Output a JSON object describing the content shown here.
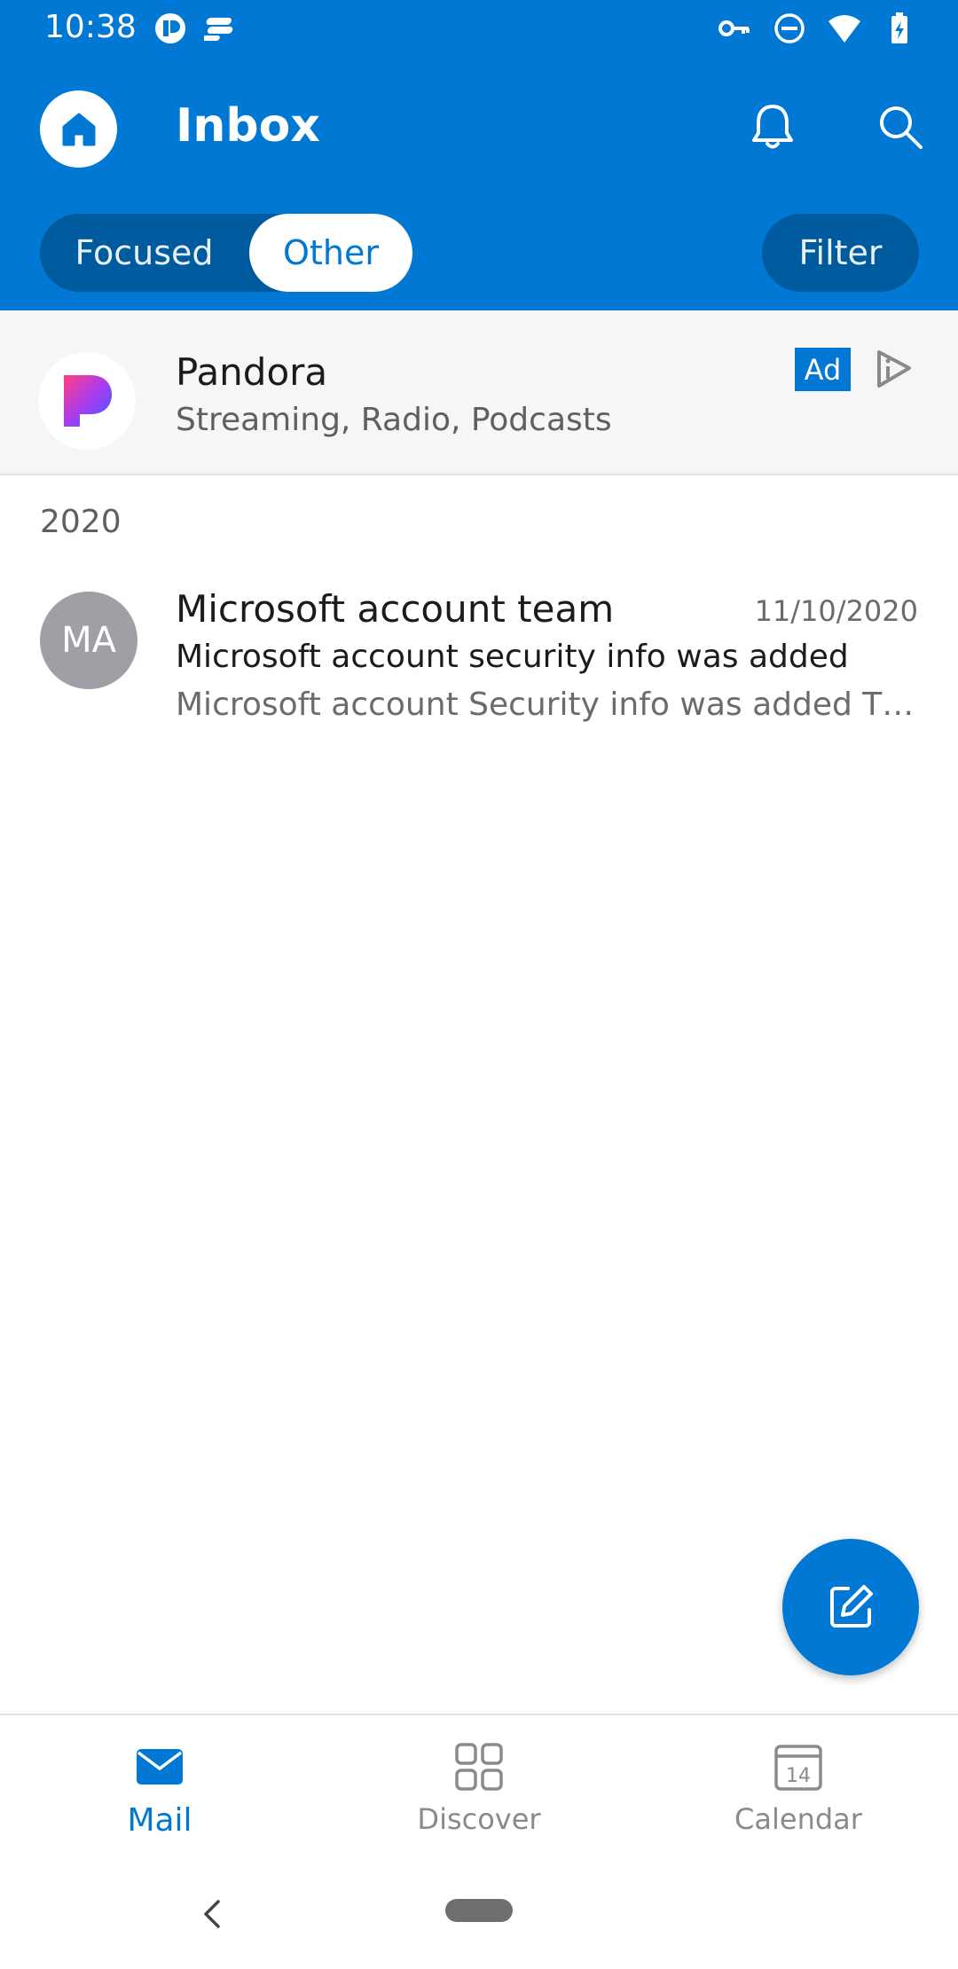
{
  "status_bar": {
    "time": "10:38"
  },
  "header": {
    "title": "Inbox"
  },
  "tabs": {
    "focused_label": "Focused",
    "other_label": "Other",
    "active": "Other"
  },
  "filter": {
    "label": "Filter"
  },
  "ad": {
    "title": "Pandora",
    "subtitle": "Streaming, Radio, Podcasts",
    "badge": "Ad"
  },
  "section": {
    "year": "2020"
  },
  "mail_items": [
    {
      "avatar_initials": "MA",
      "sender": "Microsoft account team",
      "date": "11/10/2020",
      "subject": "Microsoft account security info was added",
      "preview": "Microsoft account Security info was added The following security info was recently added"
    }
  ],
  "bottom_nav": {
    "items": [
      {
        "label": "Mail",
        "icon": "mail-icon",
        "active": true
      },
      {
        "label": "Discover",
        "icon": "grid-icon",
        "active": false
      },
      {
        "label": "Calendar",
        "icon": "calendar-icon",
        "calendar_day": "14",
        "active": false
      }
    ]
  },
  "colors": {
    "brand": "#0078d4",
    "brand_dark": "#005a9e",
    "avatar": "#a19fa6"
  }
}
